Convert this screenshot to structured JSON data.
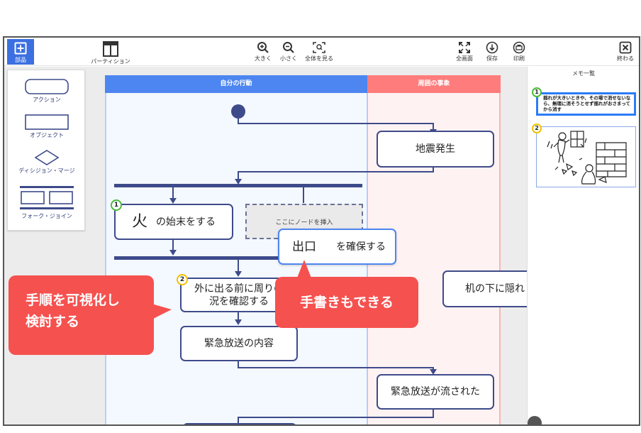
{
  "toolbar": {
    "parts_label": "部品",
    "partition_label": "パーティション",
    "zoom_in_label": "大きく",
    "zoom_out_label": "小さく",
    "fit_label": "全体を見る",
    "fullscreen_label": "全画面",
    "save_label": "保存",
    "print_label": "印刷",
    "finish_label": "終わる"
  },
  "palette": {
    "action_label": "アクション",
    "object_label": "オブジェクト",
    "decision_label": "ディシジョン・マージ",
    "fork_label": "フォーク・ジョイン"
  },
  "lanes": {
    "self_label": "自分の行動",
    "env_label": "周囲の事象"
  },
  "nodes": {
    "earthquake": "地震発生",
    "fire_text": "の始末をする",
    "fire_handwritten": "火",
    "placeholder": "ここにノードを挿入",
    "exit_handwritten": "出口",
    "exit_text": "を確保する",
    "check_line1": "外に出る前に周りの",
    "check_line2": "況を確認する",
    "broadcast_content": "緊急放送の内容",
    "broadcast_played": "緊急放送が流された",
    "under_desk": "机の下に隠れ"
  },
  "badges": {
    "b1": "1",
    "b2": "2",
    "m1": "1",
    "m2": "2"
  },
  "callouts": {
    "visualize_line1": "手順を可視化し",
    "visualize_line2": "検討する",
    "handwriting": "手書きもできる"
  },
  "memo": {
    "title": "メモ一覧",
    "note1": "揺れが大きいときや、その場で消せないなら、無理に消そうとせず揺れがおさまってから消す"
  },
  "colors": {
    "accent": "#3c6fe0",
    "lane_self": "#4d86f0",
    "lane_env": "#ff7c7c",
    "node_border": "#3e4b8a",
    "callout": "#f5514f"
  }
}
